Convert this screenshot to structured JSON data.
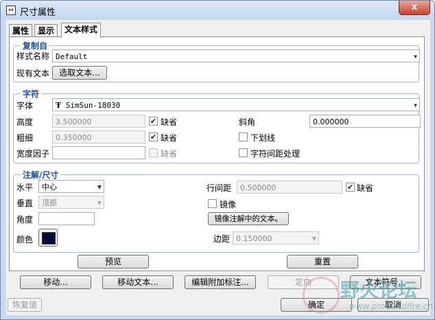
{
  "window": {
    "title": "尺寸属性",
    "close_symbol": "x"
  },
  "tabs": [
    "属性",
    "显示",
    "文本样式"
  ],
  "copy_from": {
    "title": "复制自",
    "style_name_label": "样式名称",
    "style_name_value": "Default",
    "existing_text_label": "现有文本",
    "select_text_button": "选取文本..."
  },
  "character": {
    "title": "字符",
    "font_label": "字体",
    "font_value": "SimSun-18030",
    "height_label": "高度",
    "height_value": "3.500000",
    "height_default_label": "缺省",
    "thickness_label": "粗细",
    "thickness_value": "0.350000",
    "thickness_default_label": "缺省",
    "width_factor_label": "宽度因子",
    "width_factor_value": "",
    "width_factor_default_label": "缺省",
    "slant_label": "斜角",
    "slant_value": "0.000000",
    "underline_label": "下划线",
    "kerning_label": "字符间距处理"
  },
  "note_dim": {
    "title": "注解/尺寸",
    "horizontal_label": "水平",
    "horizontal_value": "中心",
    "vertical_label": "垂直",
    "vertical_value": "顶部",
    "angle_label": "角度",
    "angle_value": "",
    "color_label": "颜色",
    "color_hex": "#0a0a3c",
    "line_spacing_label": "行间距",
    "line_spacing_value": "0.500000",
    "line_spacing_default_label": "缺省",
    "mirror_label": "镜像",
    "mirror_note_button": "镜像注解中的文本。",
    "margin_label": "边距",
    "margin_value": "0.150000"
  },
  "panel_buttons": {
    "preview": "预览",
    "reset": "重置"
  },
  "bottom_buttons": {
    "move": "移动...",
    "move_text": "移动文本...",
    "edit_attach": "编辑附加标注...",
    "orient": "定向",
    "text_symbol": "文本符号...",
    "restore": "恢复值",
    "ok": "确定",
    "cancel": "取消"
  },
  "watermark": {
    "text": "野火论坛",
    "sub": "www.proewildfire.cn"
  }
}
